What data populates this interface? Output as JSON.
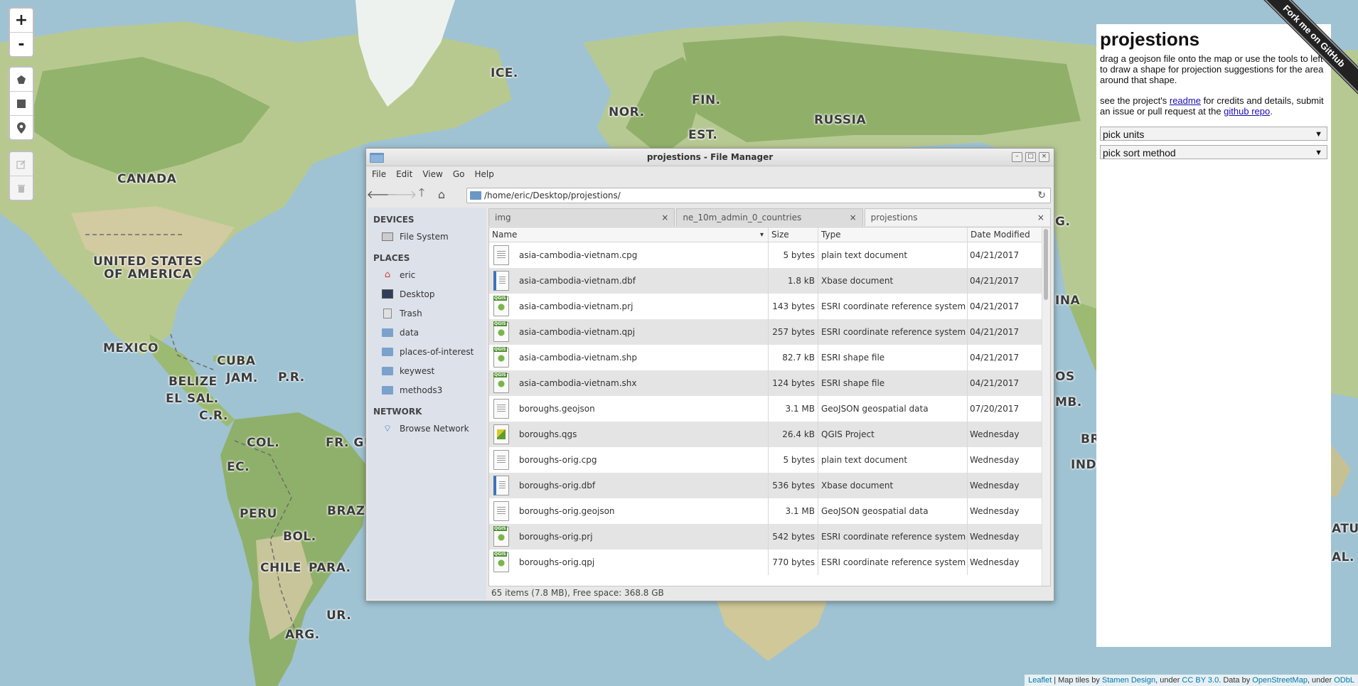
{
  "map": {
    "labels": [
      "ICE.",
      "NOR.",
      "FIN.",
      "EST.",
      "RUSSIA",
      "CANADA",
      "UNITED STATES\nOF AMERICA",
      "MEXICO",
      "CUBA",
      "JAM.",
      "P.R.",
      "BELIZE",
      "EL SAL.",
      "C.R.",
      "COL.",
      "FR. GU",
      "EC.",
      "PERU",
      "BRAZI",
      "BOL.",
      "CHILE",
      "PARA.",
      "ARG.",
      "UR.",
      "G.",
      "INA",
      "OS",
      "MB.",
      "BR",
      "INDO",
      "ATU",
      "AL."
    ]
  },
  "leaflet": {
    "zoom_in": "+",
    "zoom_out": "-"
  },
  "panel": {
    "title": "projestions",
    "intro": "drag a geojson file onto the map or use the tools to left to draw a shape for projection suggestions for the area around that shape.",
    "credits_pre": "see the project's ",
    "readme_link": "readme",
    "credits_mid": " for credits and details, submit an issue or pull request at the ",
    "repo_link": "github repo",
    "credits_post": ".",
    "units_select": "pick units",
    "sort_select": "pick sort method",
    "ribbon": "Fork me on GitHub"
  },
  "attribution": {
    "leaflet": "Leaflet",
    "t1": " | Map tiles by ",
    "stamen": "Stamen Design",
    "t2": ", under ",
    "ccby": "CC BY 3.0",
    "t3": ". Data by ",
    "osm": "OpenStreetMap",
    "t4": ", under ",
    "odbl": "ODbL"
  },
  "file_manager": {
    "title": "projestions - File Manager",
    "menu": [
      "File",
      "Edit",
      "View",
      "Go",
      "Help"
    ],
    "path": "/home/eric/Desktop/projestions/",
    "sidebar": {
      "devices_header": "DEVICES",
      "devices": [
        "File System"
      ],
      "places_header": "PLACES",
      "places": [
        "eric",
        "Desktop",
        "Trash",
        "data",
        "places-of-interest",
        "keywest",
        "methods3"
      ],
      "network_header": "NETWORK",
      "network": [
        "Browse Network"
      ]
    },
    "tabs": [
      {
        "label": "img",
        "close": "×"
      },
      {
        "label": "ne_10m_admin_0_countries",
        "close": "×"
      },
      {
        "label": "projestions",
        "close": "×"
      }
    ],
    "columns": {
      "name": "Name",
      "size": "Size",
      "type": "Type",
      "date": "Date Modified"
    },
    "sort_arrow": "▾",
    "files": [
      {
        "name": "asia-cambodia-vietnam.cpg",
        "size": "5 bytes",
        "type": "plain text document",
        "date": "04/21/2017",
        "icon": "text"
      },
      {
        "name": "asia-cambodia-vietnam.dbf",
        "size": "1.8 kB",
        "type": "Xbase document",
        "date": "04/21/2017",
        "icon": "dbf"
      },
      {
        "name": "asia-cambodia-vietnam.prj",
        "size": "143 bytes",
        "type": "ESRI coordinate reference system",
        "date": "04/21/2017",
        "icon": "qgis"
      },
      {
        "name": "asia-cambodia-vietnam.qpj",
        "size": "257 bytes",
        "type": "ESRI coordinate reference system",
        "date": "04/21/2017",
        "icon": "qgis"
      },
      {
        "name": "asia-cambodia-vietnam.shp",
        "size": "82.7 kB",
        "type": "ESRI shape file",
        "date": "04/21/2017",
        "icon": "qgis"
      },
      {
        "name": "asia-cambodia-vietnam.shx",
        "size": "124 bytes",
        "type": "ESRI shape file",
        "date": "04/21/2017",
        "icon": "qgis"
      },
      {
        "name": "boroughs.geojson",
        "size": "3.1 MB",
        "type": "GeoJSON geospatial data",
        "date": "07/20/2017",
        "icon": "text"
      },
      {
        "name": "boroughs.qgs",
        "size": "26.4 kB",
        "type": "QGIS Project",
        "date": "Wednesday",
        "icon": "qgs"
      },
      {
        "name": "boroughs-orig.cpg",
        "size": "5 bytes",
        "type": "plain text document",
        "date": "Wednesday",
        "icon": "text"
      },
      {
        "name": "boroughs-orig.dbf",
        "size": "536 bytes",
        "type": "Xbase document",
        "date": "Wednesday",
        "icon": "dbf"
      },
      {
        "name": "boroughs-orig.geojson",
        "size": "3.1 MB",
        "type": "GeoJSON geospatial data",
        "date": "Wednesday",
        "icon": "text"
      },
      {
        "name": "boroughs-orig.prj",
        "size": "542 bytes",
        "type": "ESRI coordinate reference system",
        "date": "Wednesday",
        "icon": "qgis"
      },
      {
        "name": "boroughs-orig.qpj",
        "size": "770 bytes",
        "type": "ESRI coordinate reference system",
        "date": "Wednesday",
        "icon": "qgis"
      }
    ],
    "status": "65 items (7.8 MB), Free space: 368.8 GB"
  },
  "colors": {
    "ocean": "#9fc3d3",
    "land": "#c9d5a4",
    "forest": "#8fb06a",
    "ice": "#eef2ee",
    "sidebar_bg": "#dde1ea",
    "ribbon": "#222222"
  }
}
